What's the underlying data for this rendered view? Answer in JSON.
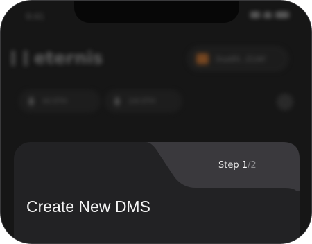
{
  "status_bar": {
    "time": "9:41"
  },
  "header": {
    "brand": "eternis",
    "wallet_address": "0xa69...E1AF"
  },
  "balances": [
    {
      "label": "40 ETH"
    },
    {
      "label": "2/6 ETH"
    }
  ],
  "sheet": {
    "step_prefix": "Step ",
    "step_current": "1",
    "step_separator": "/",
    "step_total": "2",
    "title": "Create New DMS"
  },
  "colors": {
    "background": "#161616",
    "sheet": "#222224",
    "step_tab": "#3a393d",
    "text": "#f4f4f4",
    "muted": "#8d8d90"
  }
}
